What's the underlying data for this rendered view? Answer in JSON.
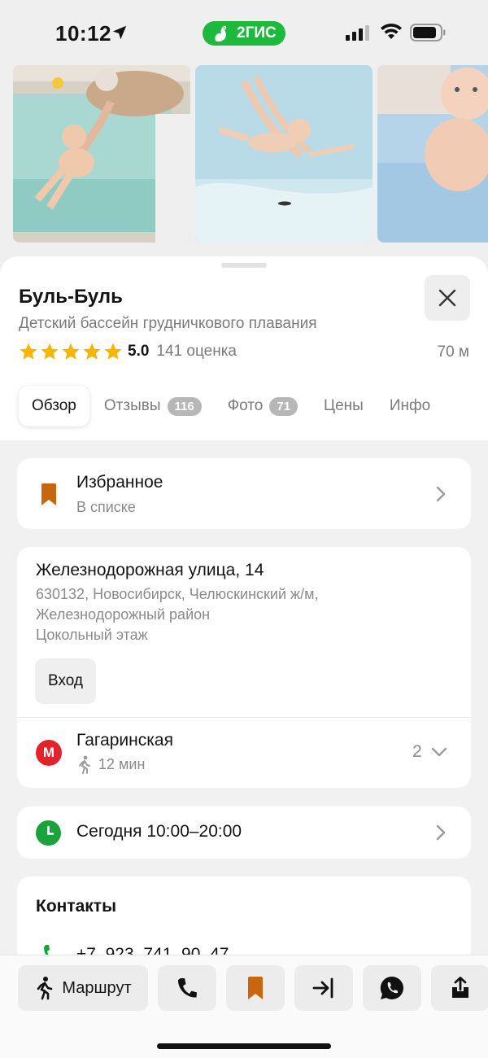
{
  "status_bar": {
    "time": "10:12",
    "app_badge": "2ГИС"
  },
  "place": {
    "name": "Буль-Буль",
    "category": "Детский бассейн грудничкового плавания",
    "rating": "5.0",
    "rating_count": "141 оценка",
    "stars": 5,
    "distance": "70 м"
  },
  "tabs": [
    {
      "label": "Обзор",
      "count": ""
    },
    {
      "label": "Отзывы",
      "count": "116"
    },
    {
      "label": "Фото",
      "count": "71"
    },
    {
      "label": "Цены",
      "count": ""
    },
    {
      "label": "Инфо",
      "count": ""
    }
  ],
  "favorites": {
    "title": "Избранное",
    "subtitle": "В списке"
  },
  "address": {
    "street": "Железнодорожная улица, 14",
    "line1": "630132, Новосибирск, Челюскинский ж/м,",
    "line2": "Железнодорожный район",
    "line3": "Цокольный этаж",
    "entry_button": "Вход"
  },
  "metro": {
    "icon_letter": "М",
    "station": "Гагаринская",
    "walk_time": "12 мин",
    "count": "2"
  },
  "hours": {
    "text": "Сегодня 10:00–20:00"
  },
  "contacts": {
    "title": "Контакты",
    "phone": "+7‒923‒741‒90‒47"
  },
  "bottom_bar": {
    "route_label": "Маршрут"
  },
  "colors": {
    "brand_green": "#1db93c",
    "star_yellow": "#f7b500",
    "bookmark_orange": "#c8660f",
    "metro_red": "#e3222b",
    "clock_green": "#1aa33a"
  }
}
